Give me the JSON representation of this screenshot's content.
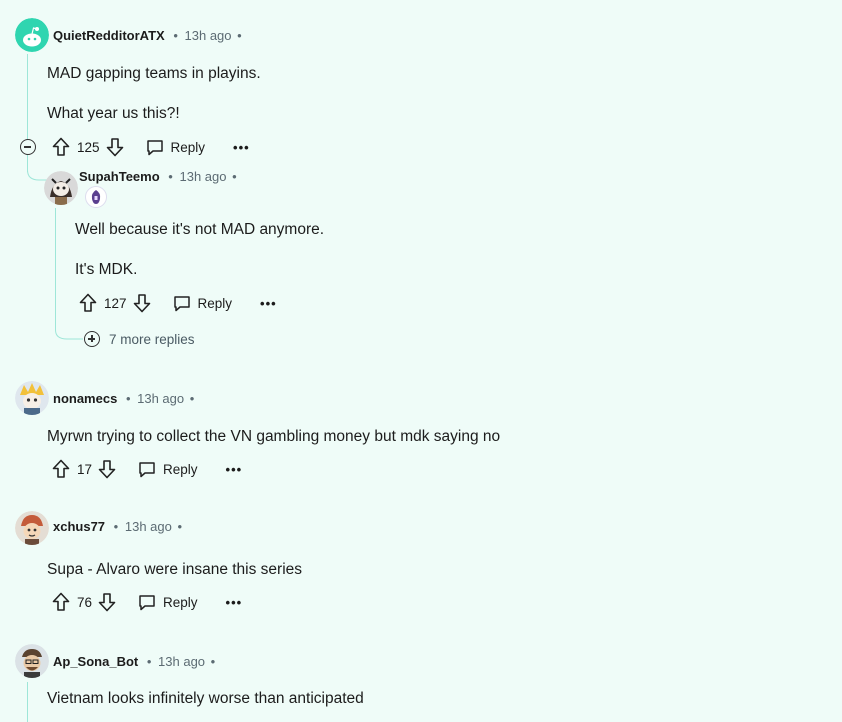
{
  "comments": [
    {
      "author": "QuietRedditorATX",
      "time": "13h ago",
      "body": [
        "MAD gapping teams in playins.",
        "What year us this?!"
      ],
      "votes": "125",
      "reply_label": "Reply",
      "avatar_color": "#2fd5b0"
    },
    {
      "author": "SupahTeemo",
      "time": "13h ago",
      "body": [
        "Well because it's not MAD anymore.",
        "It's MDK."
      ],
      "votes": "127",
      "reply_label": "Reply",
      "more_replies": "7 more replies"
    },
    {
      "author": "nonamecs",
      "time": "13h ago",
      "body": [
        "Myrwn trying to collect the VN gambling money but mdk saying no"
      ],
      "votes": "17",
      "reply_label": "Reply"
    },
    {
      "author": "xchus77",
      "time": "13h ago",
      "body": [
        "Supa - Alvaro were insane this series"
      ],
      "votes": "76",
      "reply_label": "Reply"
    },
    {
      "author": "Ap_Sona_Bot",
      "time": "13h ago",
      "body": [
        "Vietnam looks infinitely worse than anticipated"
      ]
    }
  ],
  "separator": "•",
  "more_label": "•••"
}
